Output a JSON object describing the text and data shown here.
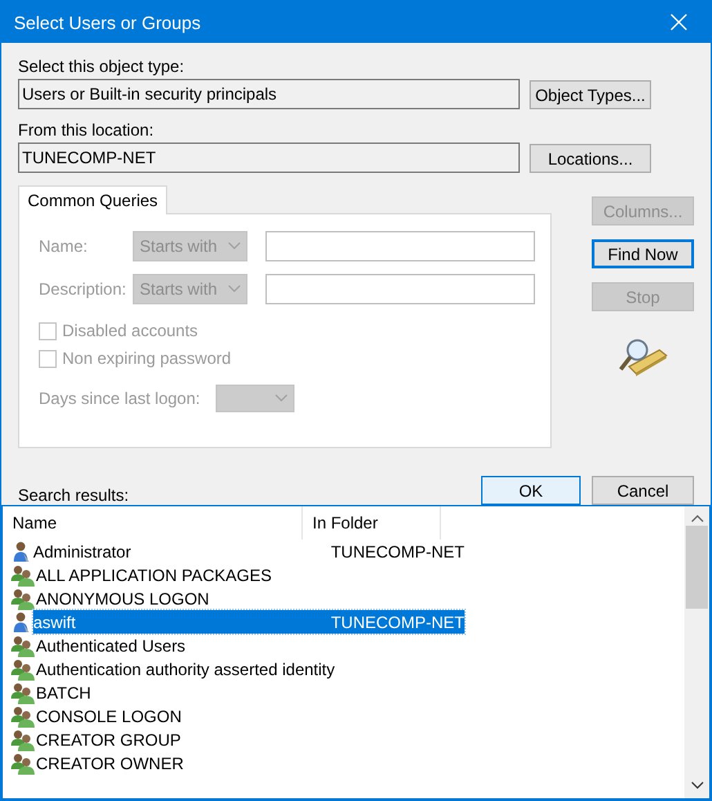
{
  "window": {
    "title": "Select Users or Groups"
  },
  "object_type": {
    "label": "Select this object type:",
    "value": "Users or Built-in security principals",
    "button": "Object Types..."
  },
  "location": {
    "label": "From this location:",
    "value": "TUNECOMP-NET",
    "button": "Locations..."
  },
  "tabs": [
    {
      "label": "Common Queries",
      "selected": true
    }
  ],
  "query": {
    "disabled": true,
    "name_label": "Name:",
    "name_mode": "Starts with",
    "description_label": "Description:",
    "description_mode": "Starts with",
    "days_label": "Days since last logon:",
    "checkboxes": [
      {
        "label": "Disabled accounts",
        "checked": false
      },
      {
        "label": "Non expiring password",
        "checked": false
      }
    ]
  },
  "side_buttons": [
    {
      "label": "Columns...",
      "disabled": true,
      "focused": false
    },
    {
      "label": "Find Now",
      "disabled": false,
      "focused": true
    },
    {
      "label": "Stop",
      "disabled": true,
      "focused": false
    }
  ],
  "dialog_buttons": [
    {
      "label": "OK",
      "highlighted": true
    },
    {
      "label": "Cancel",
      "highlighted": false
    }
  ],
  "results": {
    "label": "Search results:",
    "columns": [
      "Name",
      "In Folder"
    ],
    "rows": [
      {
        "kind": "user",
        "name": "Administrator",
        "folder": "TUNECOMP-NET",
        "selected": false
      },
      {
        "kind": "group",
        "name": "ALL APPLICATION PACKAGES",
        "selected": false
      },
      {
        "kind": "group",
        "name": "ANONYMOUS LOGON",
        "selected": false
      },
      {
        "kind": "user",
        "name": "aswift",
        "folder": "TUNECOMP-NET",
        "selected": true
      },
      {
        "kind": "group",
        "name": "Authenticated Users",
        "selected": false
      },
      {
        "kind": "group",
        "name": "Authentication authority asserted identity",
        "selected": false
      },
      {
        "kind": "group",
        "name": "BATCH",
        "selected": false
      },
      {
        "kind": "group",
        "name": "CONSOLE LOGON",
        "selected": false
      },
      {
        "kind": "group",
        "name": "CREATOR GROUP",
        "selected": false
      },
      {
        "kind": "group",
        "name": "CREATOR OWNER",
        "selected": false
      }
    ]
  }
}
